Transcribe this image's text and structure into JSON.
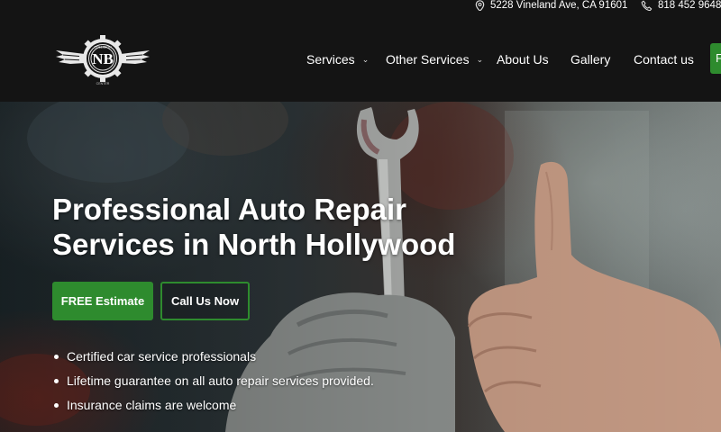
{
  "topbar": {
    "address": "5228 Vineland Ave, CA 91601",
    "phone": "818 452 9648",
    "address_icon": "map-pin-icon",
    "phone_icon": "phone-icon"
  },
  "logo": {
    "initials": "NB",
    "ring_text": "COLLISION",
    "bottom_text": "CENTER"
  },
  "nav": {
    "items": [
      {
        "label": "Services",
        "dropdown": true
      },
      {
        "label": "Other Services",
        "dropdown": true
      },
      {
        "label": "About Us",
        "dropdown": false
      },
      {
        "label": "Gallery",
        "dropdown": false
      },
      {
        "label": "Contact us",
        "dropdown": false
      }
    ],
    "cta_label": "F"
  },
  "hero": {
    "title_line1": "Professional Auto Repair",
    "title_line2": "Services in North Hollywood",
    "primary_button": "FREE Estimate",
    "secondary_button": "Call Us Now",
    "bullets": [
      "Certified car service professionals",
      "Lifetime guarantee on all auto repair services provided.",
      "Insurance claims are welcome"
    ]
  },
  "colors": {
    "accent_green": "#2e8b2e",
    "header_bg": "#141414"
  }
}
